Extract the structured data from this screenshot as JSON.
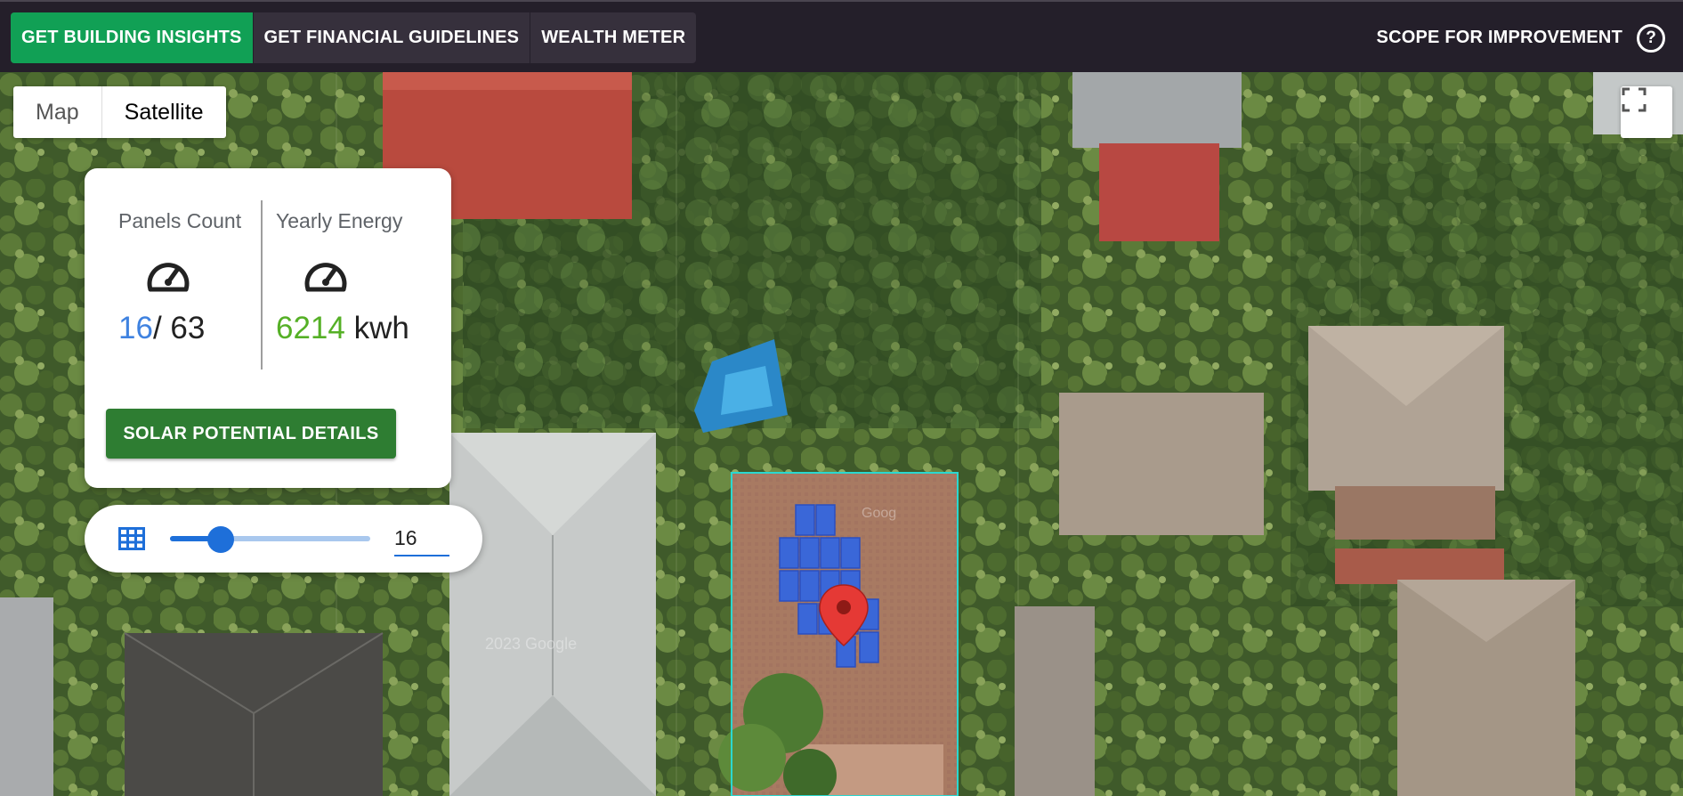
{
  "nav": {
    "tabs": [
      {
        "label": "GET BUILDING INSIGHTS"
      },
      {
        "label": "GET FINANCIAL GUIDELINES"
      },
      {
        "label": "WEALTH METER"
      }
    ],
    "scope_label": "SCOPE FOR IMPROVEMENT",
    "help_symbol": "?"
  },
  "colors": {
    "active_tab": "#11a055",
    "nav_bg": "#241f2a",
    "accent_blue": "#3f82e0",
    "accent_green": "#55b026",
    "button_green": "#2e7d32",
    "slider_blue": "#1e6fd9",
    "outline_cyan": "#2ad8d0",
    "panel_blue": "#3a67d8",
    "marker_red": "#e53935"
  },
  "map": {
    "type_buttons": [
      {
        "label": "Map",
        "selected": false
      },
      {
        "label": "Satellite",
        "selected": true
      }
    ],
    "fullscreen_icon": "fullscreen-icon",
    "marker_icon": "map-pin-icon",
    "watermark": "2023 Google",
    "watermark_small": "Goog"
  },
  "card": {
    "panels": {
      "label": "Panels Count",
      "icon": "gauge-icon",
      "value": "16",
      "total": "/ 63"
    },
    "energy": {
      "label": "Yearly Energy",
      "icon": "gauge-icon",
      "value": "6214",
      "unit": "kwh"
    },
    "details_button": "SOLAR POTENTIAL DETAILS"
  },
  "slider": {
    "icon": "grid-icon",
    "value": 16,
    "min": 0,
    "max": 63,
    "field_value": "16"
  }
}
